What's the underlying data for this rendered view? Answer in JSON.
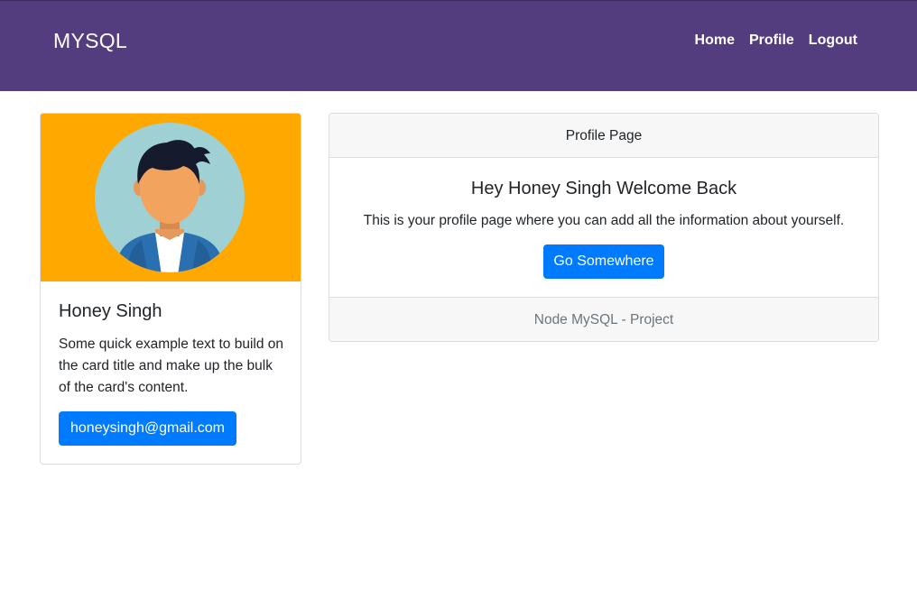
{
  "navbar": {
    "brand": "MYSQL",
    "links": [
      {
        "label": "Home"
      },
      {
        "label": "Profile"
      },
      {
        "label": "Logout"
      }
    ],
    "bg_color": "#543d7e"
  },
  "profile_card": {
    "image": "user-avatar-illustration",
    "name": "Honey Singh",
    "text": "Some quick example text to build on the card title and make up the bulk of the card's content.",
    "email_button": "honeysingh@gmail.com"
  },
  "main_card": {
    "header": "Profile Page",
    "title": "Hey Honey Singh Welcome Back",
    "text": "This is your profile page where you can add all the information about yourself.",
    "button": "Go Somewhere",
    "footer": "Node MySQL - Project"
  },
  "colors": {
    "primary": "#007bff",
    "avatar_bg": "#ffa800"
  }
}
